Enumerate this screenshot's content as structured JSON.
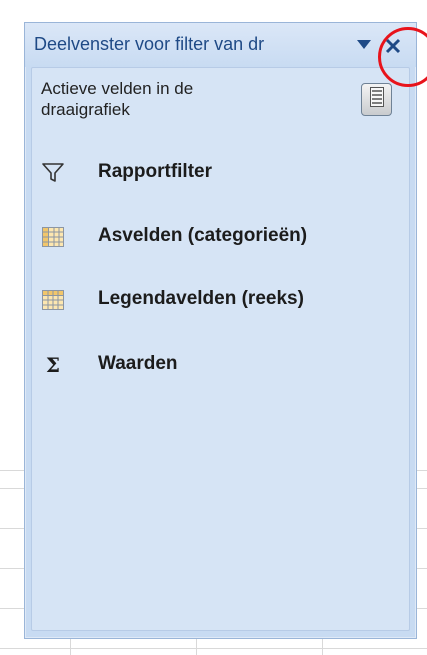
{
  "pane": {
    "title": "Deelvenster voor filter van dr",
    "dropdown_icon": "triangle-down-icon",
    "close_icon": "close-icon",
    "close_symbol": "×",
    "active_fields_label": "Actieve velden in de draaigrafiek",
    "layout_button_icon": "field-list-layout-icon",
    "highlight_color": "#e8131b",
    "areas": [
      {
        "label": "Rapportfilter",
        "icon": "filter-icon"
      },
      {
        "label": "Asvelden (categorieën)",
        "icon": "grid-icon"
      },
      {
        "label": "Legendavelden (reeks)",
        "icon": "grid-icon"
      },
      {
        "label": "Waarden",
        "icon": "sigma-icon",
        "symbol": "Σ"
      }
    ]
  }
}
